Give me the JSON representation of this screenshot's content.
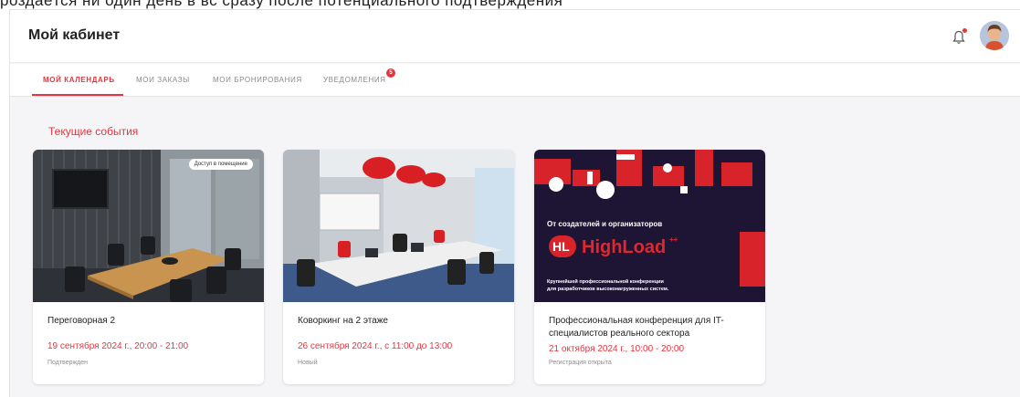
{
  "header": {
    "title": "Мой кабинет"
  },
  "tabs": [
    {
      "label": "Мой календарь",
      "active": true
    },
    {
      "label": "Мои заказы",
      "active": false
    },
    {
      "label": "Мои бронирования",
      "active": false
    },
    {
      "label": "Уведомления",
      "active": false,
      "badge": "5"
    }
  ],
  "section": {
    "title": "Текущие события"
  },
  "cards": [
    {
      "title": "Переговорная 2",
      "date": "19 сентября 2024 г., 20:00 - 21:00",
      "status": "Подтвержден",
      "image_badge": "Доступ в помещение"
    },
    {
      "title": "Коворкинг на 2 этаже",
      "date": "26 сентября 2024 г., с 11:00 до 13:00",
      "status": "Новый"
    },
    {
      "title": "Профессиональная конференция для IT-специалистов реального сектора",
      "date": "21 октября 2024 г., 10:00 - 20:00",
      "status": "Регистрация открыта",
      "image_text": {
        "subtitle": "От создателей и организаторов",
        "logo": "HL",
        "brand": "HighLoad",
        "brand_sup": "++",
        "tagline_1": "Крупнейшей профессиональной конференции",
        "tagline_2": "для разработчиков высоконагруженных систем."
      }
    }
  ],
  "colors": {
    "accent": "#e8343f",
    "poster_bg": "#1e1534"
  }
}
